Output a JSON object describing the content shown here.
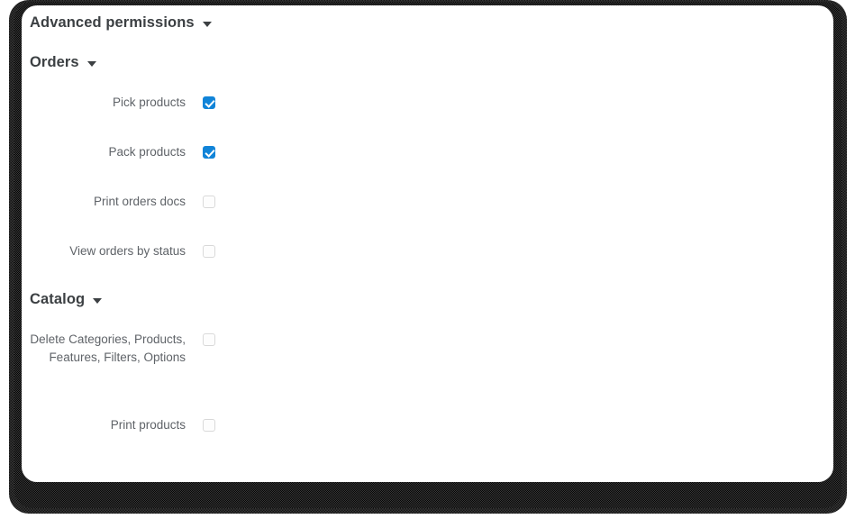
{
  "card": {
    "title": "Advanced permissions",
    "title_caret_icon": "chevron-down-icon"
  },
  "sections": [
    {
      "id": "orders",
      "title": "Orders",
      "caret_icon": "chevron-down-icon",
      "permissions": [
        {
          "label": "Pick products",
          "checked": true
        },
        {
          "label": "Pack products",
          "checked": true
        },
        {
          "label": "Print orders docs",
          "checked": false
        },
        {
          "label": "View orders by status",
          "checked": false
        }
      ]
    },
    {
      "id": "catalog",
      "title": "Catalog",
      "caret_icon": "chevron-down-icon",
      "permissions": [
        {
          "label": "Delete Categories, Products, Features, Filters, Options",
          "checked": false
        },
        {
          "label": "Print products",
          "checked": false
        }
      ]
    }
  ],
  "colors": {
    "checkbox_checked": "#1184d8",
    "checkbox_unchecked_border": "#d8d8d8",
    "heading_text": "#3c4043",
    "label_text": "#5f6368",
    "card_background": "#ffffff"
  }
}
